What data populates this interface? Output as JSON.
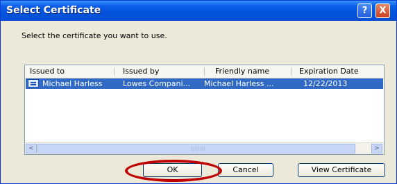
{
  "window": {
    "title": "Select Certificate"
  },
  "titlebar_buttons": {
    "help": "?",
    "close": "X"
  },
  "prompt": "Select the certificate you want to use.",
  "list": {
    "columns": [
      "Issued to",
      "Issued by",
      "Friendly name",
      "Expiration Date"
    ],
    "rows": [
      {
        "issued_to": "Michael Harless",
        "issued_by": "Lowes Compani...",
        "friendly_name": "Michael Harless ...",
        "expiration": "12/22/2013",
        "selected": true
      }
    ]
  },
  "scrollbar": {
    "left_arrow": "<",
    "right_arrow": ">",
    "grip": "|||||||"
  },
  "buttons": {
    "ok": "OK",
    "cancel": "Cancel",
    "view": "View Certificate"
  },
  "colors": {
    "titlebar": "#0453dc",
    "selection": "#316ac5",
    "highlight": "#c00000",
    "dialog_bg": "#ece9d8"
  }
}
